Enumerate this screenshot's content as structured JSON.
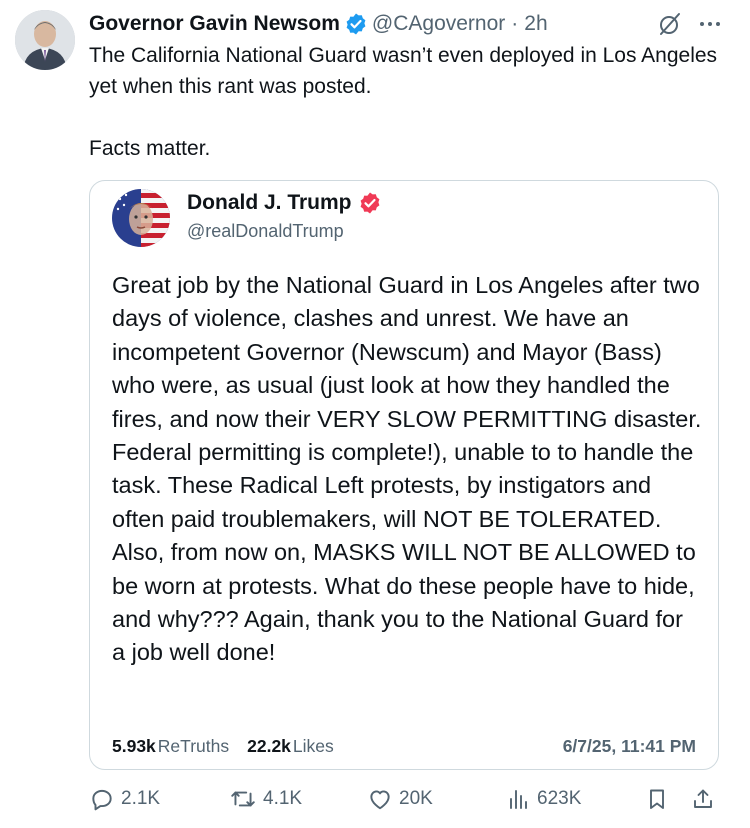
{
  "post": {
    "author_name": "Governor Gavin Newsom",
    "author_handle": "@CAgovernor",
    "separator": "·",
    "time": "2h",
    "text": "The California National Guard wasn’t even deployed in Los Angeles yet when this rant was posted.\n\nFacts matter."
  },
  "quote": {
    "author_name": "Donald J. Trump",
    "author_handle": "@realDonaldTrump",
    "text": "Great job by the National Guard in Los Angeles after two days of violence, clashes and unrest. We have an incompetent Governor (Newscum) and Mayor (Bass) who were, as usual (just look at how they handled the fires, and now their VERY SLOW PERMITTING disaster. Federal permitting is complete!), unable to to handle the task. These Radical Left protests, by instigators and often paid troublemakers, will NOT BE TOLERATED. Also, from now on, MASKS WILL NOT BE ALLOWED to be worn at protests. What do these people have to hide, and why??? Again, thank you to the National Guard for a job well done!",
    "retruths_count": "5.93k",
    "retruths_label": "ReTruths",
    "likes_count": "22.2k",
    "likes_label": "Likes",
    "date": "6/7/25, 11:41 PM"
  },
  "actions": {
    "replies": "2.1K",
    "reposts": "4.1K",
    "likes": "20K",
    "views": "623K"
  },
  "icons": {
    "verified": "verified-badge-icon",
    "grok": "grok-icon",
    "more": "more-icon",
    "truth_badge": "truth-verified-icon",
    "reply": "reply-icon",
    "repost": "repost-icon",
    "like": "heart-icon",
    "views": "views-icon",
    "bookmark": "bookmark-icon",
    "share": "share-icon"
  },
  "colors": {
    "text": "#0f1419",
    "secondary": "#536471",
    "verified_blue": "#1d9bf0",
    "truth_badge": "#f03a56",
    "border": "#cfd9de"
  }
}
